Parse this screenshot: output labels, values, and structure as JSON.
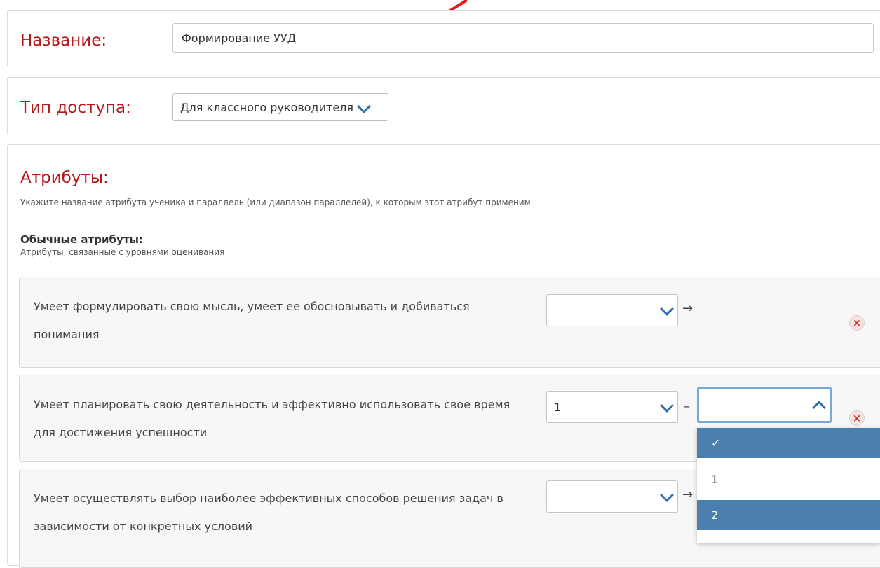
{
  "form": {
    "name_label": "Название:",
    "name_value": "Формирование УУД",
    "access_label": "Тип доступа:",
    "access_value": "Для классного руководителя"
  },
  "attributes": {
    "title": "Атрибуты:",
    "description": "Укажите название атрибута ученика и параллель (или диапазон параллелей), к которым этот атрибут применим",
    "ordinary_title": "Обычные атрибуты:",
    "ordinary_description": "Атрибуты, связанные с уровнями оценивания",
    "rows": [
      {
        "text": "Умеет формулировать свою мысль, умеет ее обосновывать и добиваться понимания",
        "from": "",
        "separator": "→",
        "to": ""
      },
      {
        "text": "Умеет планировать свою деятельность и эффективно использовать свое время для достижения успешности",
        "from": "1",
        "separator": "–",
        "to": ""
      },
      {
        "text": "Умеет осуществлять выбор наиболее эффективных способов решения задач в зависимости от конкретных условий",
        "from": "",
        "separator": "→",
        "to": ""
      }
    ],
    "remove_symbol": "×"
  },
  "dropdown": {
    "options": [
      "✓",
      "1",
      "2"
    ]
  },
  "colors": {
    "accent_red": "#b5191c",
    "dropdown_highlight": "#4a7fae",
    "annotation_arrow": "#e41b1b"
  }
}
